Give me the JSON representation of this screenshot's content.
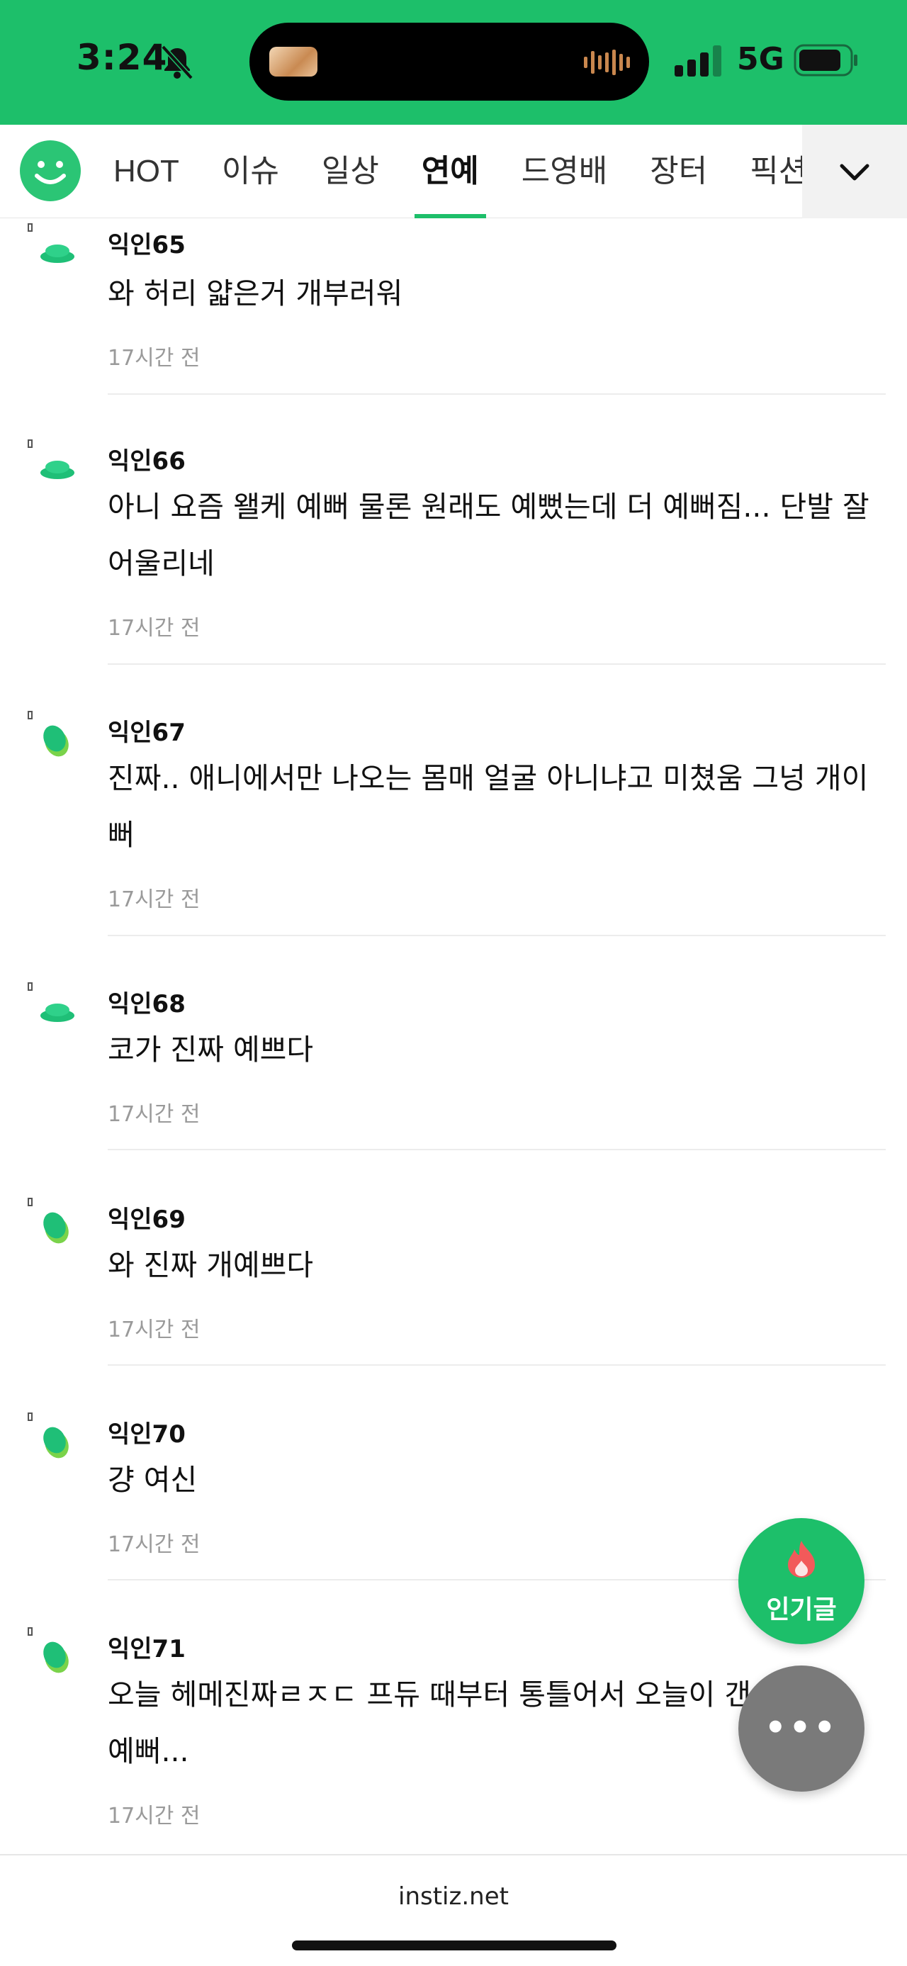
{
  "status_bar": {
    "time": "3:24",
    "network": "5G",
    "icons": [
      "bell-slash-icon",
      "signal-icon",
      "battery-icon"
    ]
  },
  "category_nav": {
    "tabs": [
      {
        "label": "HOT"
      },
      {
        "label": "이슈"
      },
      {
        "label": "일상"
      },
      {
        "label": "연예",
        "active": true
      },
      {
        "label": "드영배"
      },
      {
        "label": "장터"
      },
      {
        "label": "픽션"
      }
    ],
    "icons": [
      "smile-logo-icon",
      "chevron-down-icon"
    ]
  },
  "comments": [
    {
      "nick": "익인65",
      "text": [
        "와 허리 얇은거 개부러워"
      ],
      "time": "17시간 전",
      "avatar": "green-flat"
    },
    {
      "nick": "익인66",
      "text": [
        "아니 요즘 왤케 예뻐 물론 원래도 예뻤는데 더 예뻐짐... 단발 잘",
        "어울리네"
      ],
      "time": "17시간 전",
      "avatar": "green-flat"
    },
    {
      "nick": "익인67",
      "text": [
        "진짜.. 애니에서만 나오는 몸매 얼굴 아니냐고 미쳤움 그넝 개이",
        "뻐"
      ],
      "time": "17시간 전",
      "avatar": "green-leaf"
    },
    {
      "nick": "익인68",
      "text": [
        "코가 진짜 예쁘다"
      ],
      "time": "17시간 전",
      "avatar": "green-flat"
    },
    {
      "nick": "익인69",
      "text": [
        "와 진짜 개예쁘다"
      ],
      "time": "17시간 전",
      "avatar": "green-leaf"
    },
    {
      "nick": "익인70",
      "text": [
        "걍 여신"
      ],
      "time": "17시간 전",
      "avatar": "green-leaf"
    },
    {
      "nick": "익인71",
      "text": [
        "오늘 헤메진짜ㄹㅈㄷ 프듀 때부터 통틀어서 오늘이 갠",
        "예뻐..."
      ],
      "time": "17시간 전",
      "avatar": "green-leaf"
    }
  ],
  "fab": {
    "hot_label": "인기글",
    "more_label": "•••"
  },
  "footer": {
    "domain": "instiz.net"
  },
  "colors": {
    "brand_green": "#1dbf6a",
    "avatar_green": "#1fbf77",
    "avatar_lime": "#7ad34a",
    "fab_gray": "#7a7a7a",
    "flame": "#f25a5a"
  }
}
